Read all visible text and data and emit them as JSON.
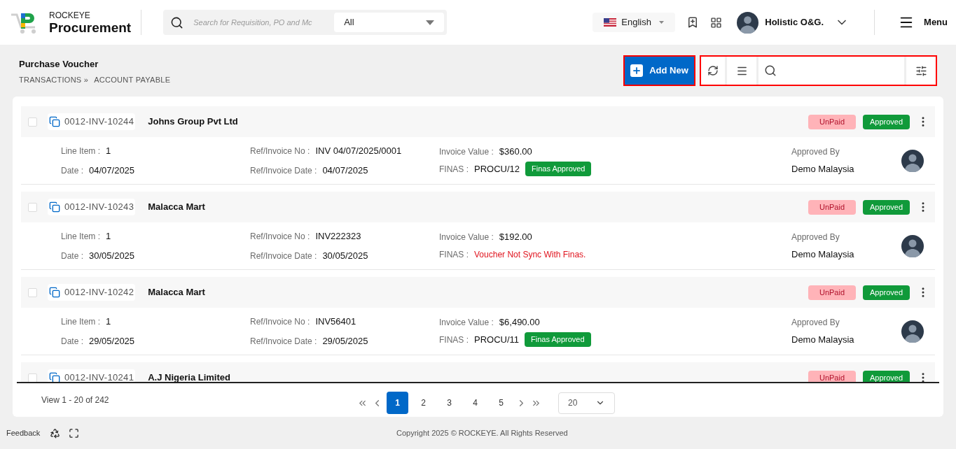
{
  "header": {
    "brand_top": "ROCKEYE",
    "brand_name": "Procurement",
    "search": {
      "placeholder": "Search for Requisition, PO and Mc",
      "scope": "All"
    },
    "language": "English",
    "user": "Holistic O&G.",
    "menu": "Menu"
  },
  "page": {
    "title": "Purchase Voucher",
    "breadcrumb": [
      "TRANSACTIONS »",
      "ACCOUNT PAYABLE"
    ],
    "add_button": "Add New"
  },
  "vouchers": [
    {
      "checked": false,
      "number": "0012-INV-10244",
      "supplier": "Johns Group Pvt Ltd",
      "payment": "UnPaid",
      "status": "Approved",
      "labels": {
        "line_item": "Line Item :",
        "date": "Date :",
        "ref_no": "Ref/Invoice No :",
        "ref_date": "Ref/Invoice Date :",
        "invoice_value": "Invoice Value :",
        "finas": "FINAS :",
        "approved_by": "Approved By"
      },
      "line_item": "1",
      "date": "04/07/2025",
      "ref_no": "INV 04/07/2025/0001",
      "ref_date": "04/07/2025",
      "invoice_value": "$360.00",
      "finas": {
        "kind": "approved",
        "code": "PROCU/12",
        "badge": "Finas Approved"
      },
      "approver": "Demo Malaysia"
    },
    {
      "checked": false,
      "number": "0012-INV-10243",
      "supplier": "Malacca Mart",
      "payment": "UnPaid",
      "status": "Approved",
      "labels": {
        "line_item": "Line Item :",
        "date": "Date :",
        "ref_no": "Ref/Invoice No :",
        "ref_date": "Ref/Invoice Date :",
        "invoice_value": "Invoice Value :",
        "finas": "FINAS :",
        "approved_by": "Approved By"
      },
      "line_item": "1",
      "date": "30/05/2025",
      "ref_no": "INV222323",
      "ref_date": "30/05/2025",
      "invoice_value": "$192.00",
      "finas": {
        "kind": "error",
        "message": "Voucher Not Sync With Finas."
      },
      "approver": "Demo Malaysia"
    },
    {
      "checked": false,
      "number": "0012-INV-10242",
      "supplier": "Malacca Mart",
      "payment": "UnPaid",
      "status": "Approved",
      "labels": {
        "line_item": "Line Item :",
        "date": "Date :",
        "ref_no": "Ref/Invoice No :",
        "ref_date": "Ref/Invoice Date :",
        "invoice_value": "Invoice Value :",
        "finas": "FINAS :",
        "approved_by": "Approved By"
      },
      "line_item": "1",
      "date": "29/05/2025",
      "ref_no": "INV56401",
      "ref_date": "29/05/2025",
      "invoice_value": "$6,490.00",
      "finas": {
        "kind": "approved",
        "code": "PROCU/11",
        "badge": "Finas Approved"
      },
      "approver": "Demo Malaysia"
    },
    {
      "checked": false,
      "number": "0012-INV-10241",
      "supplier": "A.J Nigeria Limited",
      "payment": "UnPaid",
      "status": "Approved"
    }
  ],
  "pagination": {
    "summary": "View 1 - 20 of 242",
    "pages": [
      {
        "label": "1",
        "selected": true
      },
      {
        "label": "2",
        "selected": false
      },
      {
        "label": "3",
        "selected": false
      },
      {
        "label": "4",
        "selected": false
      },
      {
        "label": "5",
        "selected": false
      }
    ],
    "page_size": "20"
  },
  "footer": {
    "feedback": "Feedback",
    "copyright": "Copyright 2025 © ROCKEYE. All Rights Reserved"
  }
}
